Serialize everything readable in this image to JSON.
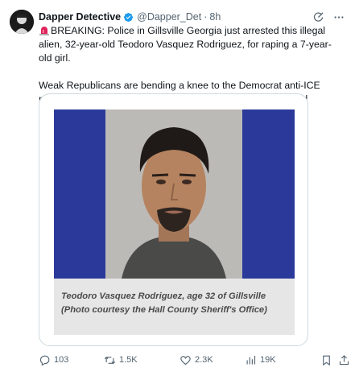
{
  "tweet": {
    "author": {
      "display_name": "Dapper Detective",
      "handle": "@Dapper_Det",
      "time": "8h",
      "avatar_icon": "avatar-image",
      "verified_icon": "verified-badge-icon",
      "verified_color": "#1d9bf0"
    },
    "text": {
      "line1": "BREAKING: Police in Gillsville Georgia just arrested this illegal alien, 32-year-old Teodoro Vasquez Rodriguez, for raping a 7-year-old girl.",
      "line2": "Weak Republicans are bending a knee to the Democrat anti-ICE mobs for Renee Good and Alex Pretti, both Leftists who killed themselves.",
      "emoji": "siren-emoji"
    },
    "media": {
      "caption_line1": "Teodoro Vasquez Rodriguez, age 32 of Gillsville",
      "caption_line2": "(Photo courtesy the Hall County Sheriff's Office)",
      "frame_color": "#2b3a9a"
    },
    "actions": {
      "replies": "103",
      "reposts": "1.5K",
      "likes": "2.3K",
      "views": "19K"
    }
  },
  "colors": {
    "text": "#0f1419",
    "secondary": "#536471",
    "border": "#cfd9de"
  }
}
